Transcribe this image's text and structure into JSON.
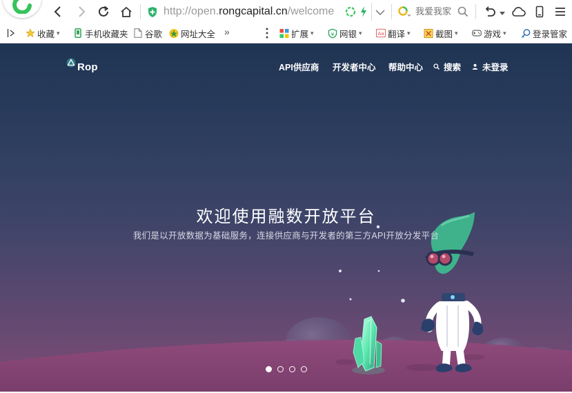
{
  "browser": {
    "url_prefix": "http://open.",
    "url_domain": "rongcapital.cn",
    "url_path": "/welcome",
    "search_placeholder": "我爱我家"
  },
  "bookmarks": [
    {
      "label": "收藏",
      "icon": "star-icon",
      "dropdown": true
    },
    {
      "label": "手机收藏夹",
      "icon": "phone-icon",
      "dropdown": false
    },
    {
      "label": "谷歌",
      "icon": "page-icon",
      "dropdown": false
    },
    {
      "label": "网址大全",
      "icon": "site-nav-icon",
      "dropdown": false
    }
  ],
  "toolbar_right": [
    {
      "label": "扩展",
      "icon": "extension-icon"
    },
    {
      "label": "网银",
      "icon": "bank-icon"
    },
    {
      "label": "翻译",
      "icon": "translate-icon"
    },
    {
      "label": "截图",
      "icon": "screenshot-icon"
    },
    {
      "label": "游戏",
      "icon": "game-icon"
    },
    {
      "label": "登录管家",
      "icon": "login-manager-icon"
    }
  ],
  "more_chevron": "»",
  "site": {
    "logo_text": "Rop",
    "nav": [
      {
        "label": "API供应商"
      },
      {
        "label": "开发者中心"
      },
      {
        "label": "帮助中心"
      },
      {
        "label": "搜索",
        "icon": "search-icon"
      },
      {
        "label": "未登录",
        "icon": "user-icon"
      }
    ]
  },
  "hero": {
    "title": "欢迎使用融数开放平台",
    "subtitle": "我们是以开放数据为基础服务，连接供应商与开发者的第三方API开放分发平台",
    "slides_total": 4,
    "slide_active": 1
  },
  "colors": {
    "hero_top": "#1f3453",
    "hero_bottom": "#7d4a75",
    "ground": "#8e4a7a",
    "crystal": "#5ee8b0",
    "alien": "#3fb28c",
    "browser_green": "#3ac45a"
  }
}
